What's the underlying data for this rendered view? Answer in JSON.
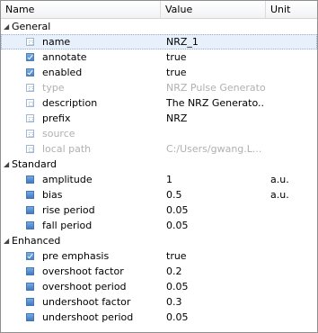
{
  "header": {
    "name": "Name",
    "value": "Value",
    "unit": "Unit"
  },
  "groups": {
    "general": {
      "label": "General",
      "rows": [
        {
          "name": "name",
          "value": "NRZ_1",
          "unit": ""
        },
        {
          "name": "annotate",
          "value": "true",
          "unit": ""
        },
        {
          "name": "enabled",
          "value": "true",
          "unit": ""
        },
        {
          "name": "type",
          "value": "NRZ Pulse Generator",
          "unit": ""
        },
        {
          "name": "description",
          "value": "The NRZ Generato...",
          "unit": ""
        },
        {
          "name": "prefix",
          "value": "NRZ",
          "unit": ""
        },
        {
          "name": "source",
          "value": "",
          "unit": ""
        },
        {
          "name": "local path",
          "value": "C:/Users/gwang.L...",
          "unit": ""
        }
      ]
    },
    "standard": {
      "label": "Standard",
      "rows": [
        {
          "name": "amplitude",
          "value": "1",
          "unit": "a.u."
        },
        {
          "name": "bias",
          "value": "0.5",
          "unit": "a.u."
        },
        {
          "name": "rise period",
          "value": "0.05",
          "unit": ""
        },
        {
          "name": "fall period",
          "value": "0.05",
          "unit": ""
        }
      ]
    },
    "enhanced": {
      "label": "Enhanced",
      "rows": [
        {
          "name": "pre emphasis",
          "value": "true",
          "unit": ""
        },
        {
          "name": "overshoot factor",
          "value": "0.2",
          "unit": ""
        },
        {
          "name": "overshoot period",
          "value": "0.05",
          "unit": ""
        },
        {
          "name": "undershoot factor",
          "value": "0.3",
          "unit": ""
        },
        {
          "name": "undershoot period",
          "value": "0.05",
          "unit": ""
        }
      ]
    }
  }
}
